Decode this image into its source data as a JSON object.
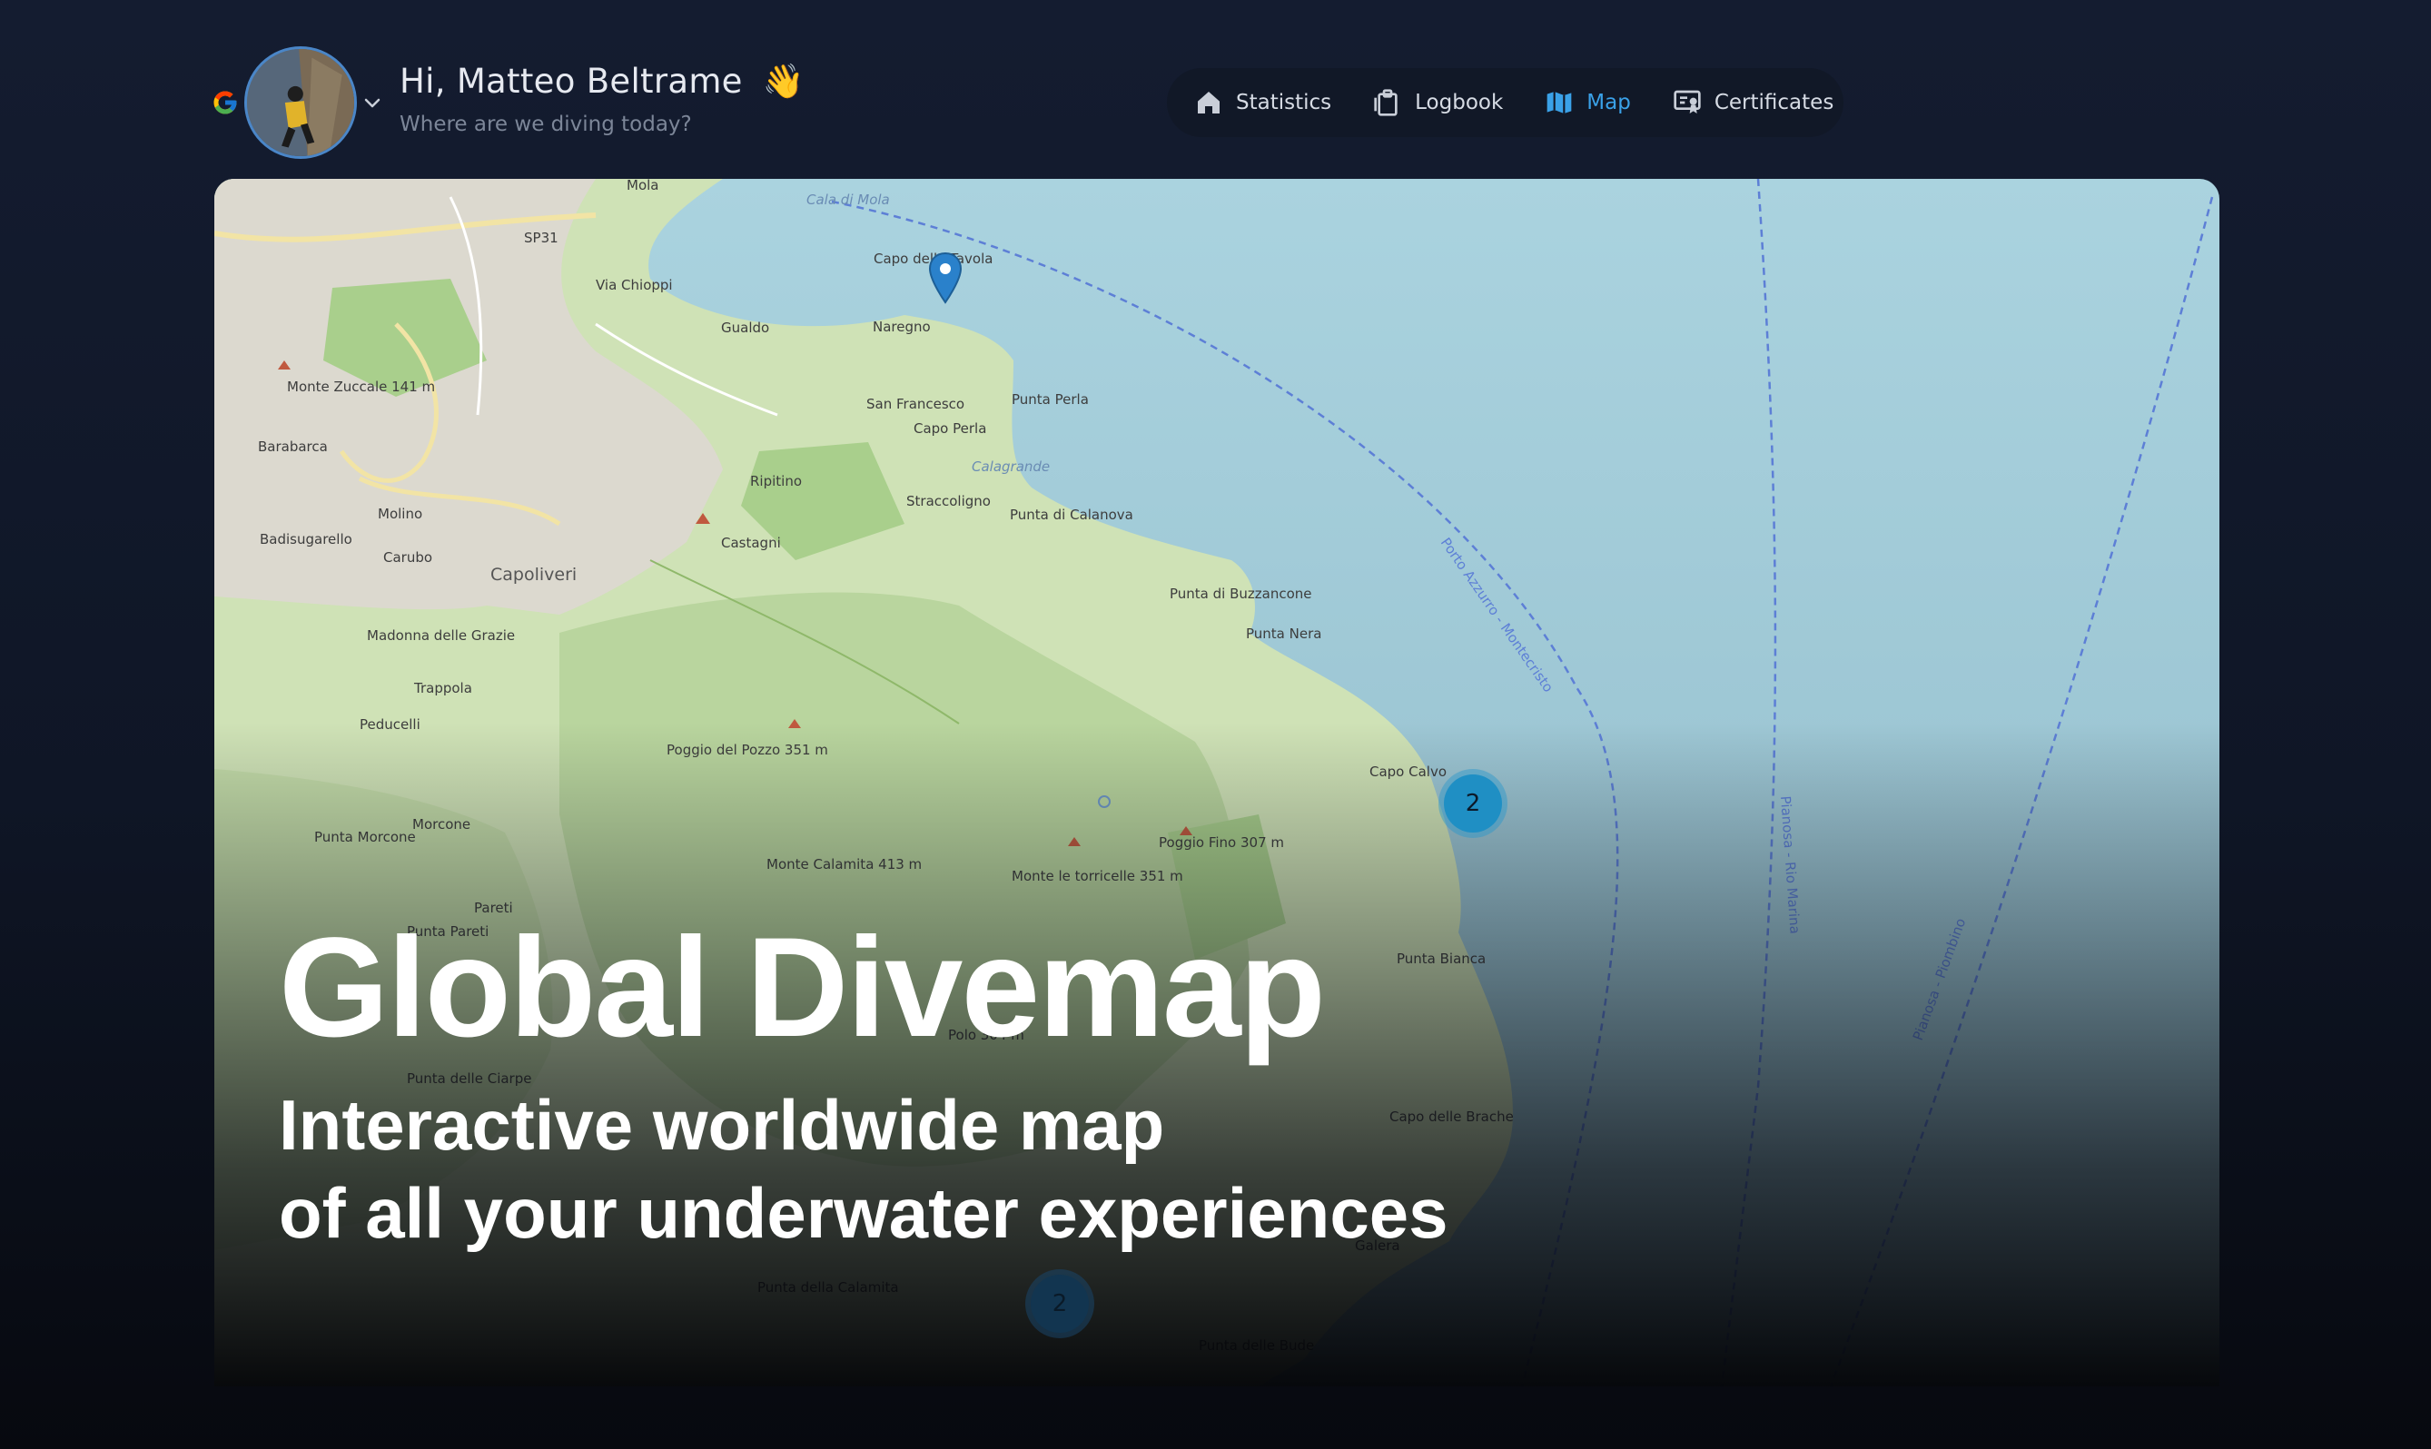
{
  "user": {
    "greeting": "Hi, Matteo Beltrame",
    "wave_emoji": "👋",
    "subtitle": "Where are we diving today?",
    "login_provider_icon": "google-icon",
    "avatar_icon": "user-avatar"
  },
  "nav": {
    "items": [
      {
        "label": "Statistics",
        "icon": "home-icon",
        "active": false
      },
      {
        "label": "Logbook",
        "icon": "clipboard-icon",
        "active": false
      },
      {
        "label": "Map",
        "icon": "map-icon",
        "active": true
      },
      {
        "label": "Certificates",
        "icon": "certificate-icon",
        "active": false
      }
    ],
    "active_color": "#3aa1e8"
  },
  "map": {
    "labels": {
      "molo": "Mola",
      "cala_di_mola": "Cala di Mola",
      "sp31": "SP31",
      "capo_tavola": "Capo della Tavola",
      "via_chioppi": "Via Chioppi",
      "gualdo": "Gualdo",
      "naregno": "Naregno",
      "monte_zuccale": "Monte Zuccale 141 m",
      "barabarca": "Barabarca",
      "san_francesco": "San Francesco",
      "capo_perla": "Capo Perla",
      "punta_perla": "Punta Perla",
      "calagrande": "Calagrande",
      "ripitino": "Ripitino",
      "straccoligno": "Straccoligno",
      "molino": "Molino",
      "castagni": "Castagni",
      "punta_calanova": "Punta di Calanova",
      "badisugarello": "Badisugarello",
      "carubo": "Carubo",
      "capoliveri": "Capoliveri",
      "punta_buzzancone": "Punta di Buzzancone",
      "madonna_grazie": "Madonna delle Grazie",
      "punta_nera": "Punta Nera",
      "trappola": "Trappola",
      "peducelli": "Peducelli",
      "poggio_pozzo": "Poggio del Pozzo 351 m",
      "capo_calvo": "Capo Calvo",
      "punta_morcone": "Punta Morcone",
      "morcone": "Morcone",
      "monte_calamita": "Monte Calamita 413 m",
      "monte_torricelle": "Monte le torricelle 351 m",
      "poggio_fino": "Poggio Fino 307 m",
      "pareti": "Pareti",
      "punta_pareti": "Punta Pareti",
      "punta_bianca": "Punta Bianca",
      "punta_ciarpe": "Punta delle Ciarpe",
      "capo_brache": "Capo delle Brache",
      "galera": "Galera",
      "punta_calamita": "Punta della Calamita",
      "punta_bude": "Punta delle Bude",
      "porto_azzurro_route": "Porto Azzurro - Montecristo",
      "pianosa_rio_route": "Pianosa - Rio Marina",
      "pianosa_piombino_route": "Pianosa - Piombino",
      "polo": "Polo 304 m"
    },
    "clusters": [
      {
        "count": "2",
        "color": "#1f8fc4"
      },
      {
        "count": "2",
        "color": "#123550"
      }
    ],
    "marker_icon": "map-pin-icon"
  },
  "hero": {
    "title": "Global Divemap",
    "line1": "Interactive worldwide map",
    "line2": "of all your underwater experiences"
  }
}
